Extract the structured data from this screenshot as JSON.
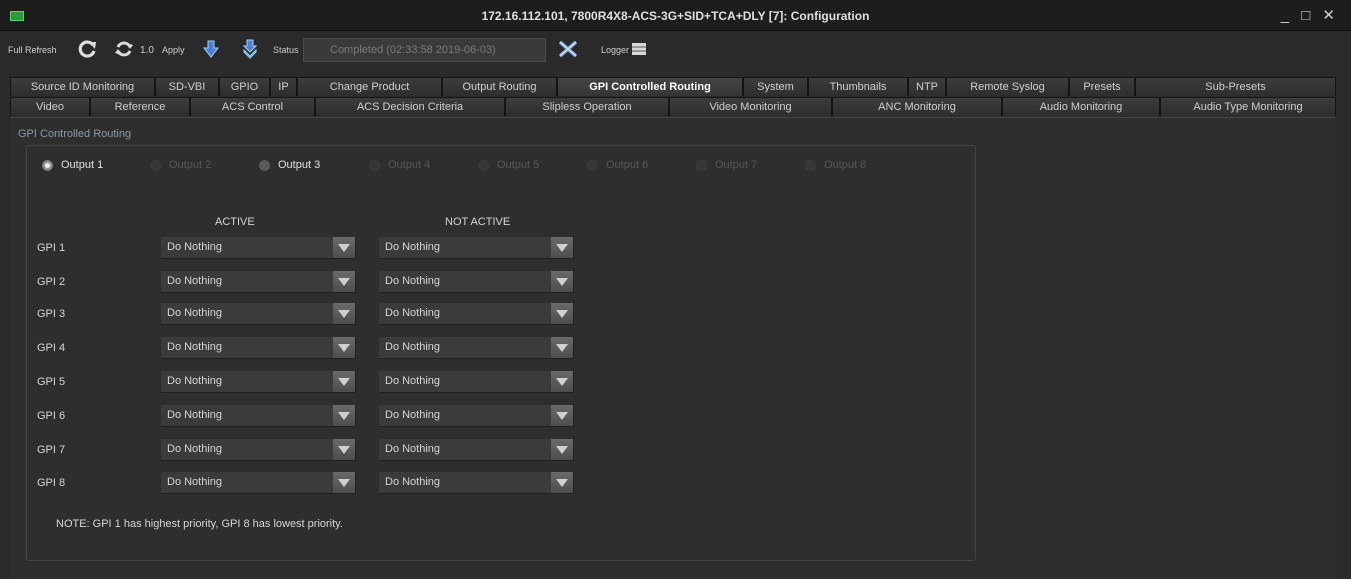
{
  "window": {
    "title": "172.16.112.101, 7800R4X8-ACS-3G+SID+TCA+DLY  [7]: Configuration",
    "controls": "_ □ ✕"
  },
  "toolbar": {
    "full_refresh": "Full Refresh",
    "refresh_rate": "1.0",
    "apply": "Apply",
    "status_label": "Status",
    "status_value": "Completed  (02:33:58 2019-06-03)",
    "logger": "Logger"
  },
  "tabs_row1": [
    "Source ID Monitoring",
    "SD-VBI",
    "GPIO",
    "IP",
    "Change Product",
    "Output Routing",
    "GPI Controlled Routing",
    "System",
    "Thumbnails",
    "NTP",
    "Remote Syslog",
    "Presets",
    "Sub-Presets"
  ],
  "tabs_row2": [
    "Video",
    "Reference",
    "ACS Control",
    "ACS Decision Criteria",
    "Slipless Operation",
    "Video Monitoring",
    "ANC Monitoring",
    "Audio Monitoring",
    "Audio Type Monitoring"
  ],
  "active_tab": "GPI Controlled Routing",
  "panel": {
    "title": "GPI Controlled Routing",
    "outputs": [
      {
        "label": "Output 1",
        "state": "selected"
      },
      {
        "label": "Output 2",
        "state": "disabled"
      },
      {
        "label": "Output 3",
        "state": "enabled"
      },
      {
        "label": "Output 4",
        "state": "disabled"
      },
      {
        "label": "Output 5",
        "state": "disabled"
      },
      {
        "label": "Output 6",
        "state": "disabled"
      },
      {
        "label": "Output 7",
        "state": "disabled"
      },
      {
        "label": "Output 8",
        "state": "disabled"
      }
    ],
    "col_active": "ACTIVE",
    "col_not_active": "NOT ACTIVE",
    "rows": [
      {
        "gpi": "GPI 1",
        "active": "Do Nothing",
        "not_active": "Do Nothing"
      },
      {
        "gpi": "GPI 2",
        "active": "Do Nothing",
        "not_active": "Do Nothing"
      },
      {
        "gpi": "GPI 3",
        "active": "Do Nothing",
        "not_active": "Do Nothing"
      },
      {
        "gpi": "GPI 4",
        "active": "Do Nothing",
        "not_active": "Do Nothing"
      },
      {
        "gpi": "GPI 5",
        "active": "Do Nothing",
        "not_active": "Do Nothing"
      },
      {
        "gpi": "GPI 6",
        "active": "Do Nothing",
        "not_active": "Do Nothing"
      },
      {
        "gpi": "GPI 7",
        "active": "Do Nothing",
        "not_active": "Do Nothing"
      },
      {
        "gpi": "GPI 8",
        "active": "Do Nothing",
        "not_active": "Do Nothing"
      }
    ],
    "note": "NOTE: GPI 1 has highest priority, GPI 8 has lowest priority."
  },
  "colors": {
    "background": "#2b2b2b",
    "tab_border": "#141414",
    "app_icon": "#2e9b3a",
    "refresh_icon": "#dcdcdc",
    "apply_arrow": "#4f7fd0",
    "logger_x": "#7fa6d8"
  }
}
